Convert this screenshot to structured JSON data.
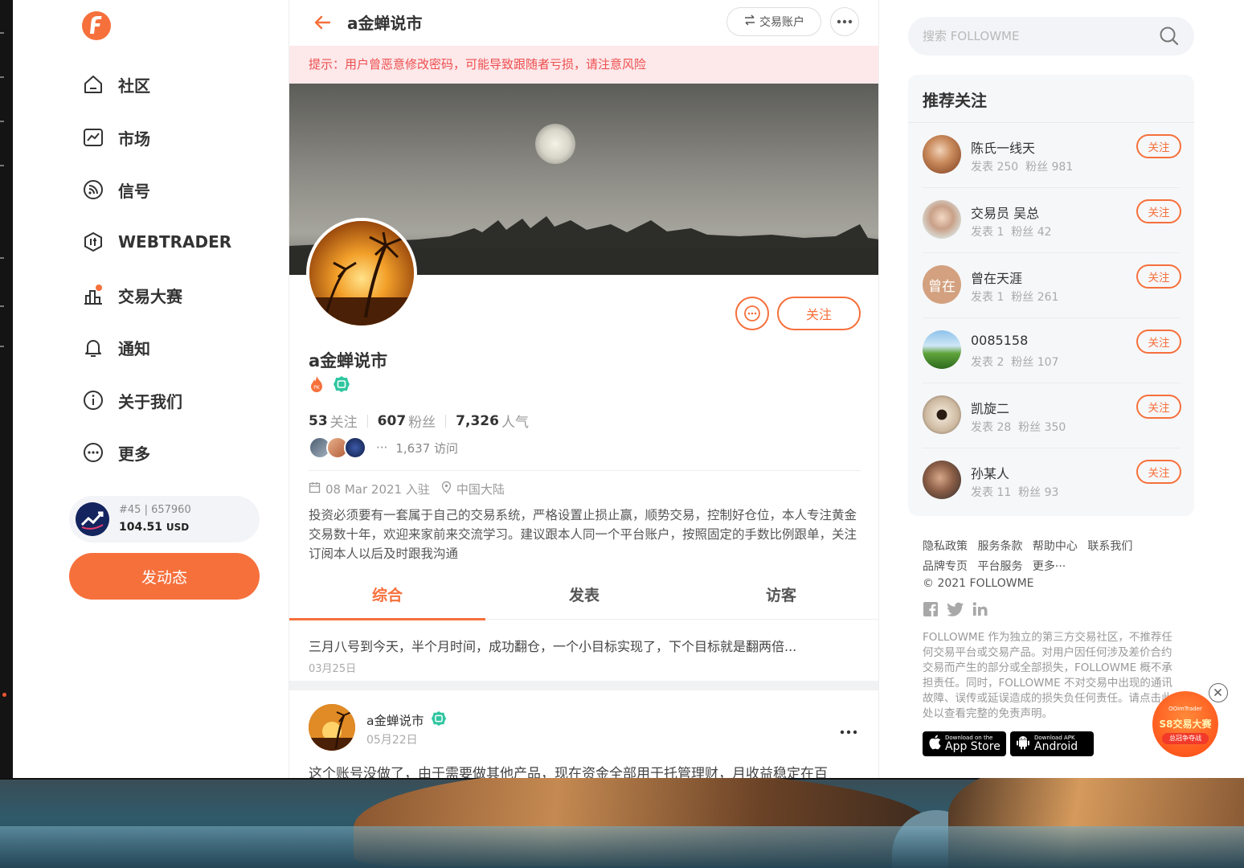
{
  "nav": {
    "items": [
      {
        "label": "社区",
        "icon": "home-icon"
      },
      {
        "label": "市场",
        "icon": "chart-icon"
      },
      {
        "label": "信号",
        "icon": "signal-icon"
      },
      {
        "label": "WEBTRADER",
        "icon": "webtrader-icon"
      },
      {
        "label": "交易大赛",
        "icon": "contest-icon"
      },
      {
        "label": "通知",
        "icon": "bell-icon"
      },
      {
        "label": "关于我们",
        "icon": "info-icon"
      },
      {
        "label": "更多",
        "icon": "more-icon"
      }
    ],
    "account": {
      "rank": "#45",
      "number": "657960",
      "balance": "104.51",
      "currency": "USD"
    },
    "post_button": "发动态"
  },
  "profile": {
    "top_title": "a金蝉说市",
    "trade_account": "交易账户",
    "warning": "提示：用户曾恶意修改密码，可能导致跟随者亏损，请注意风险",
    "follow_button": "关注",
    "name": "a金蝉说市",
    "following_count": "53",
    "following_label": "关注",
    "fans_count": "607",
    "fans_label": "粉丝",
    "popularity_count": "7,326",
    "popularity_label": "人气",
    "visits": "1,637 访问",
    "visitors_more": "···",
    "join_date": "08 Mar 2021 入驻",
    "location": "中国大陆",
    "bio": "投资必须要有一套属于自己的交易系统，严格设置止损止赢，顺势交易，控制好仓位，本人专注黄金交易数十年，欢迎来家前来交流学习。建议跟本人同一个平台账户，按照固定的手数比例跟单，关注订阅本人以后及时跟我沟通",
    "tabs": [
      "综合",
      "发表",
      "访客"
    ],
    "active_tab": "综合"
  },
  "feed": {
    "item1": {
      "text": "三月八号到今天，半个月时间，成功翻仓，一个小目标实现了，下个目标就是翻两倍...",
      "date": "03月25日"
    },
    "item2": {
      "author": "a金蝉说市",
      "date": "05月22日",
      "text": "这个账号没做了，由于需要做其他产品，现在资金全部用于托管理财，月收益稳定在百"
    }
  },
  "sidebar": {
    "search_placeholder": "搜索 FOLLOWME",
    "rec_title": "推荐关注",
    "follow_label": "关注",
    "recommendations": [
      {
        "name": "陈氏一线天",
        "posts": "发表 250",
        "fans": "粉丝 981"
      },
      {
        "name": "交易员 吴总",
        "posts": "发表 1",
        "fans": "粉丝 42"
      },
      {
        "name": "曾在天涯",
        "posts": "发表 1",
        "fans": "粉丝 261",
        "avatar_text": "曾在"
      },
      {
        "name": "0085158",
        "posts": "发表 2",
        "fans": "粉丝 107"
      },
      {
        "name": "凯旋二",
        "posts": "发表 28",
        "fans": "粉丝 350"
      },
      {
        "name": "孙某人",
        "posts": "发表 11",
        "fans": "粉丝 93"
      }
    ],
    "footer_links_row1": [
      "隐私政策",
      "服务条款",
      "帮助中心",
      "联系我们"
    ],
    "footer_links_row2": [
      "品牌专页",
      "平台服务",
      "更多···"
    ],
    "copyright": "© 2021 FOLLOWME",
    "disclaimer": "FOLLOWME 作为独立的第三方交易社区，不推荐任何交易平台或交易产品。对用户因任何涉及差价合约交易而产生的部分或全部损失，FOLLOWME 概不承担责任。同时，FOLLOWME 不对交易中出现的通讯故障、误传或延误造成的损失负任何责任。请点击此处以查看完整的免责声明。",
    "appstore_small": "Download on the",
    "appstore_big": "App Store",
    "android_small": "Download APK",
    "android_big": "Android",
    "promo_small": "OOimTrader",
    "promo_big": "S8交易大赛",
    "promo_tag": "总冠争夺战"
  },
  "colors": {
    "accent": "#f6703c",
    "warning_bg": "#fde8ea",
    "warning_text": "#ee4e4e",
    "verified": "#2fc6a0"
  }
}
